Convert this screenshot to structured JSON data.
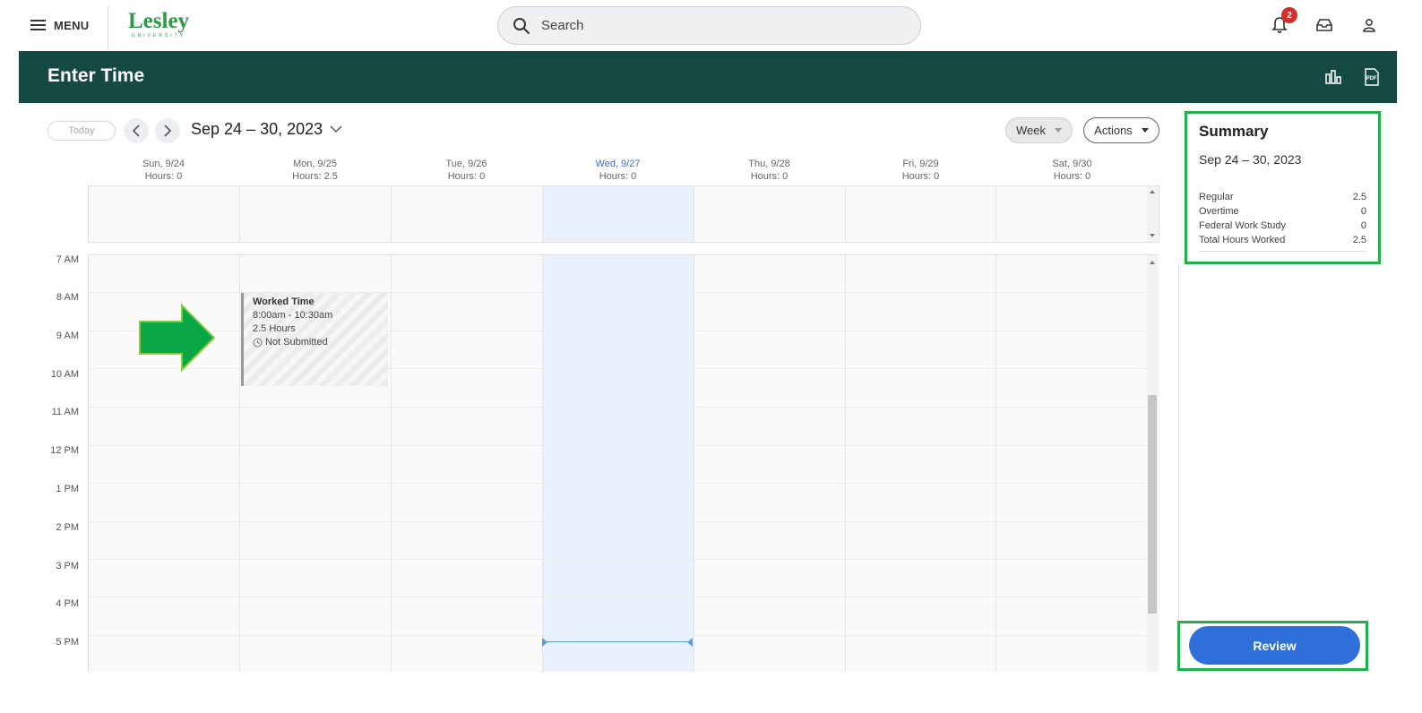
{
  "topbar": {
    "menu_label": "MENU",
    "logo_text": "Lesley",
    "logo_subtext": "UNIVERSITY",
    "search_placeholder": "Search",
    "notification_count": "2",
    "icons": [
      "menu-icon",
      "search-icon",
      "bell-icon",
      "inbox-icon",
      "user-icon"
    ]
  },
  "header": {
    "title": "Enter Time",
    "icons": [
      "bar-chart-icon",
      "pdf-icon"
    ]
  },
  "toolbar": {
    "today_label": "Today",
    "date_range": "Sep 24 – 30, 2023",
    "view_label": "Week",
    "actions_label": "Actions"
  },
  "days": [
    {
      "label": "Sun, 9/24",
      "hours": "Hours: 0"
    },
    {
      "label": "Mon, 9/25",
      "hours": "Hours: 2.5"
    },
    {
      "label": "Tue, 9/26",
      "hours": "Hours: 0"
    },
    {
      "label": "Wed, 9/27",
      "hours": "Hours: 0",
      "current": true
    },
    {
      "label": "Thu, 9/28",
      "hours": "Hours: 0"
    },
    {
      "label": "Fri, 9/29",
      "hours": "Hours: 0"
    },
    {
      "label": "Sat, 9/30",
      "hours": "Hours: 0"
    }
  ],
  "time_labels": [
    "7 AM",
    "8 AM",
    "9 AM",
    "10 AM",
    "11 AM",
    "12 PM",
    "1 PM",
    "2 PM",
    "3 PM",
    "4 PM",
    "5 PM"
  ],
  "event": {
    "title": "Worked Time",
    "time": "8:00am - 10:30am",
    "duration": "2.5 Hours",
    "status": "Not Submitted"
  },
  "summary": {
    "title": "Summary",
    "range": "Sep 24 – 30, 2023",
    "rows": [
      {
        "label": "Regular",
        "value": "2.5"
      },
      {
        "label": "Overtime",
        "value": "0"
      },
      {
        "label": "Federal Work Study",
        "value": "0"
      },
      {
        "label": "Total Hours Worked",
        "value": "2.5"
      }
    ]
  },
  "review_label": "Review",
  "colors": {
    "header_bg": "#154a44",
    "brand_green": "#2e9a45",
    "highlight_green": "#1fb24a",
    "review_blue": "#2f6fd9",
    "today_column": "#e8f1fd"
  }
}
